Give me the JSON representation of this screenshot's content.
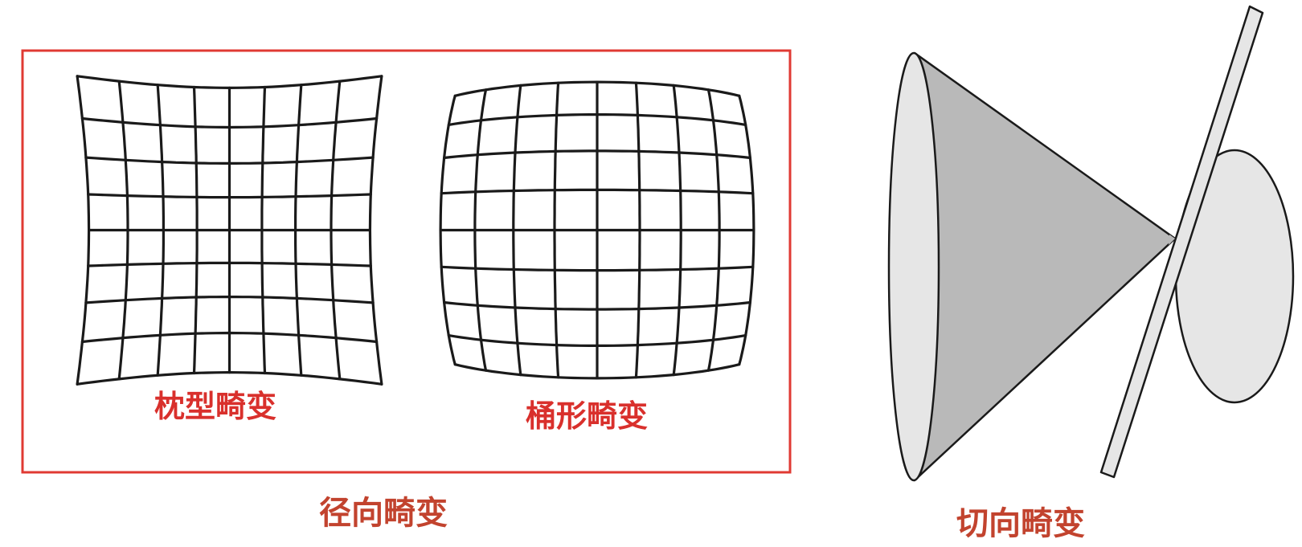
{
  "labels": {
    "pincushion": "枕型畸变",
    "barrel": "桶形畸变",
    "radial": "径向畸变",
    "tangential": "切向畸变"
  },
  "colors": {
    "frame": "#e03a33",
    "grid": "#1a1a1a",
    "cone_fill": "#b9b9b9",
    "ellipse_fill": "#e6e6e6",
    "plane_fill": "#e6e6e6"
  },
  "grids": {
    "pincushion": {
      "divisions": 8,
      "distortion": "pincushion"
    },
    "barrel": {
      "divisions": 8,
      "distortion": "barrel"
    }
  }
}
